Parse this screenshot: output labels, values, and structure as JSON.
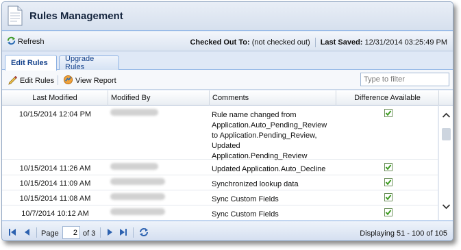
{
  "window": {
    "title": "Rules Management"
  },
  "infobar": {
    "refresh_label": "Refresh",
    "checked_out_label": "Checked Out To:",
    "checked_out_value": "(not checked out)",
    "last_saved_label": "Last Saved:",
    "last_saved_value": "12/31/2014 03:25:49 PM"
  },
  "tabs": [
    {
      "label": "Edit Rules",
      "active": true
    },
    {
      "label": "Upgrade Rules",
      "active": false
    }
  ],
  "toolbar": {
    "edit_rules_label": "Edit Rules",
    "view_report_label": "View Report",
    "filter_placeholder": "Type to filter"
  },
  "grid": {
    "columns": [
      "Last Modified",
      "Modified By",
      "Comments",
      "Difference Available"
    ],
    "rows": [
      {
        "date": "10/15/2014 12:04 PM",
        "comment": "Rule name changed from Application.Auto_Pending_Review to Application.Pending_Review, Updated Application.Pending_Review",
        "difference": true
      },
      {
        "date": "10/15/2014 11:26 AM",
        "comment": "Updated Application.Auto_Decline",
        "difference": true
      },
      {
        "date": "10/15/2014 11:09 AM",
        "comment": "Synchronized lookup data",
        "difference": true
      },
      {
        "date": "10/15/2014 11:08 AM",
        "comment": "Sync Custom Fields",
        "difference": true
      },
      {
        "date": "10/7/2014 10:12 AM",
        "comment": "Sync Custom Fields",
        "difference": true
      }
    ]
  },
  "paging": {
    "page_label": "Page",
    "current_page": "2",
    "of_label": "of 3",
    "display_text": "Displaying 51 - 100 of 105"
  },
  "colors": {
    "accent": "#15428b",
    "check_green": "#3c9a1f",
    "border": "#99bbe8"
  }
}
